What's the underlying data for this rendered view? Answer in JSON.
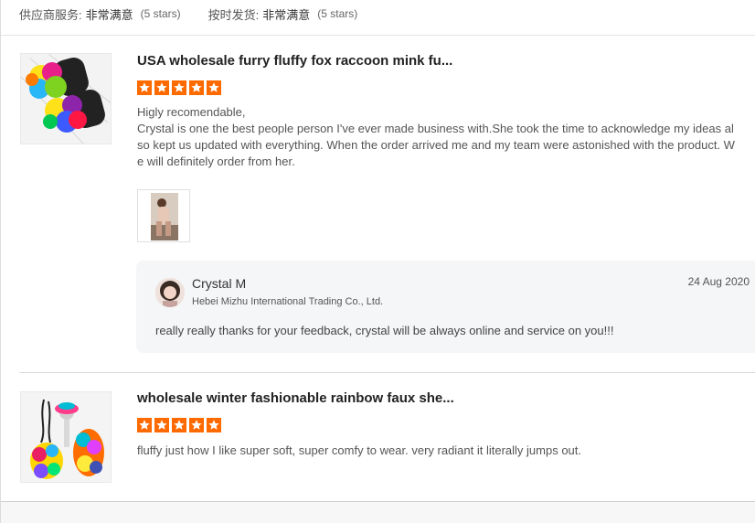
{
  "supplier_ratings": [
    {
      "label": "供应商服务:",
      "value": "非常满意",
      "stars_text": "(5 stars)"
    },
    {
      "label": "按时发货:",
      "value": "非常满意",
      "stars_text": "(5 stars)"
    }
  ],
  "reviews": [
    {
      "product_title": "USA wholesale furry fluffy fox raccoon mink fu...",
      "star_count": 5,
      "text_line1": "Higly recomendable,",
      "text_rest": "Crystal is one the best people person I've ever made business with.She took the time to acknowledge my ideas also kept us updated with everything. When the order arrived me and my team were astonished with the product. We will definitely order from her.",
      "reply": {
        "name": "Crystal M",
        "company": "Hebei Mizhu International Trading Co., Ltd.",
        "date": "24 Aug 2020",
        "text": "really really thanks for your feedback, crystal will be always online and service on you!!!"
      }
    },
    {
      "product_title": "wholesale winter fashionable rainbow faux she...",
      "star_count": 5,
      "text": "fluffy just how I like super soft, super comfy to wear. very radiant it literally jumps out."
    }
  ],
  "colors": {
    "star": "#ff6a00",
    "divider": "#e5e5e5",
    "reply_bg": "#f5f6f8"
  }
}
